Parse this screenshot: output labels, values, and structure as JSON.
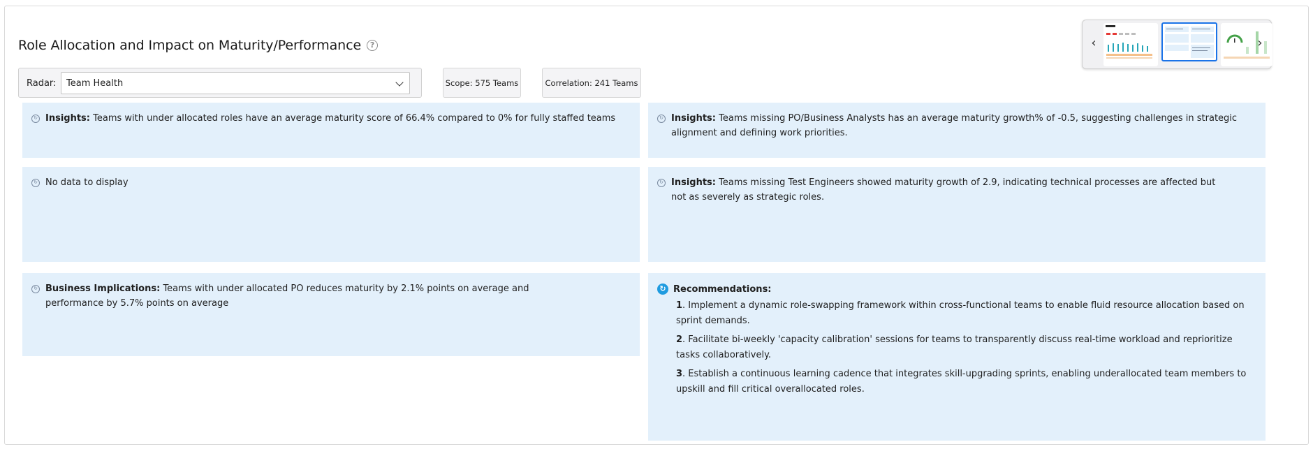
{
  "header": {
    "title": "Role Allocation and Impact on Maturity/Performance",
    "help_glyph": "?"
  },
  "filters": {
    "radar_label": "Radar:",
    "radar_value": "Team Health",
    "scope": "Scope: 575 Teams",
    "correlation": "Correlation: 241 Teams"
  },
  "carousel": {
    "prev_glyph": "‹",
    "next_glyph": "›"
  },
  "cards": {
    "insight_1": {
      "label": "Insights:",
      "text": " Teams with under allocated roles have an average maturity score of 66.4% compared to 0% for fully staffed teams"
    },
    "insight_2": {
      "label": "Insights:",
      "text": " Teams missing PO/Business Analysts has an average maturity growth% of -0.5, suggesting challenges in strategic alignment and defining work priorities."
    },
    "no_data": {
      "text": "No data to display"
    },
    "insight_3": {
      "label": "Insights:",
      "text": " Teams missing Test Engineers showed maturity growth of 2.9, indicating technical processes are affected but not as severely as strategic roles."
    },
    "business": {
      "label": "Business Implications:",
      "text": " Teams with under allocated PO reduces maturity by 2.1% points on average and performance by 5.7% points on average"
    },
    "recommendations": {
      "title": "Recommendations:",
      "items": [
        {
          "num": "1",
          "text": ". Implement a dynamic role-swapping framework within cross-functional teams to enable fluid resource allocation based on sprint demands."
        },
        {
          "num": "2",
          "text": ". Facilitate bi-weekly 'capacity calibration' sessions for teams to transparently discuss real-time workload and reprioritize tasks collaboratively."
        },
        {
          "num": "3",
          "text": ". Establish a continuous learning cadence that integrates skill-upgrading sprints, enabling underallocated team members to upskill and fill critical overallocated roles."
        }
      ]
    }
  },
  "colors": {
    "card_bg": "#e3f0fb",
    "accent": "#1e9be0",
    "thumb_selected": "#1a73e8"
  }
}
